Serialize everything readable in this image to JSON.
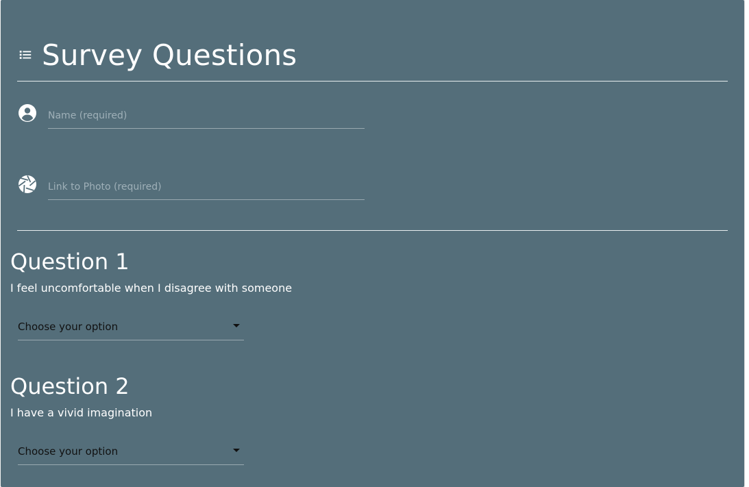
{
  "header": {
    "title": "Survey Questions",
    "icon": "list-icon"
  },
  "fields": {
    "name": {
      "placeholder": "Name (required)",
      "value": "",
      "icon": "account-circle-icon"
    },
    "photo": {
      "placeholder": "Link to Photo (required)",
      "value": "",
      "icon": "camera-shutter-icon"
    }
  },
  "questions": [
    {
      "heading": "Question 1",
      "text": "I feel uncomfortable when I disagree with someone",
      "select_value": "Choose your option"
    },
    {
      "heading": "Question 2",
      "text": "I have a vivid imagination",
      "select_value": "Choose your option"
    }
  ],
  "colors": {
    "card_background": "#546e7a",
    "text": "#ffffff",
    "placeholder": "#9fb0b8",
    "select_text": "#111111"
  }
}
